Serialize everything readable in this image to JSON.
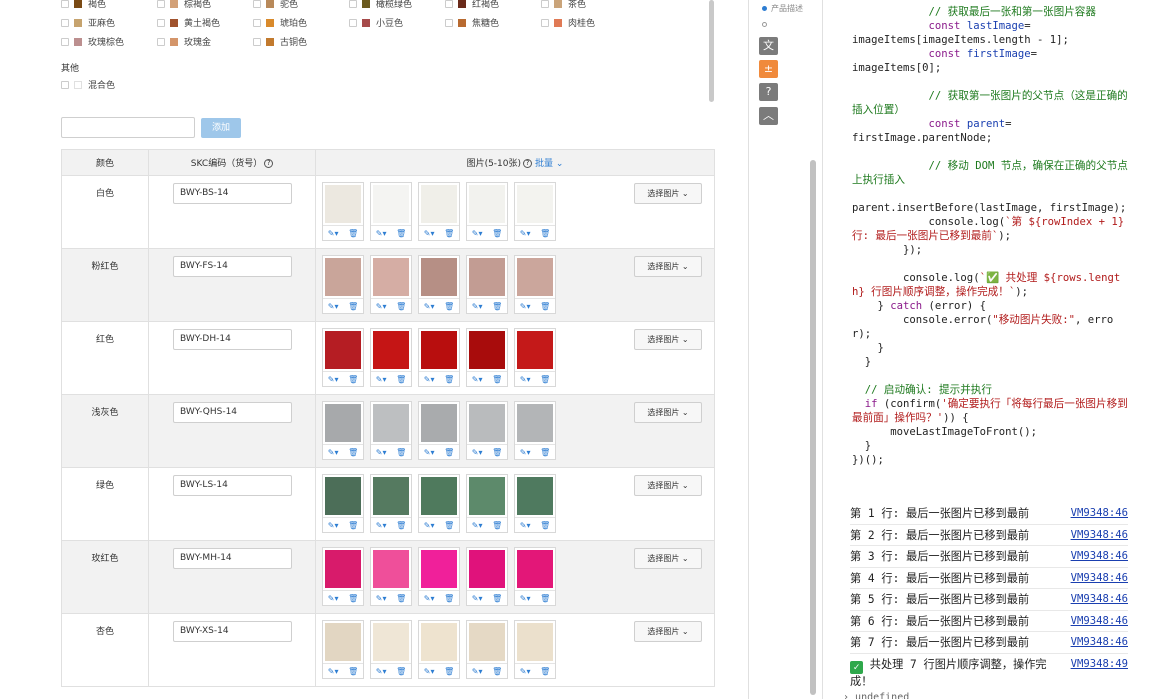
{
  "swatches": {
    "rows": [
      [
        {
          "label": "褐色",
          "color": "#7a4a14"
        },
        {
          "label": "棕褐色",
          "color": "#d2a077"
        },
        {
          "label": "驼色",
          "color": "#b8895a"
        },
        {
          "label": "橄榄绿色",
          "color": "#6b5a1e"
        },
        {
          "label": "红褐色",
          "color": "#6a2a1a"
        },
        {
          "label": "茶色",
          "color": "#caa47a"
        }
      ],
      [
        {
          "label": "亚麻色",
          "color": "#c6a36e"
        },
        {
          "label": "黄土褐色",
          "color": "#a0522d"
        },
        {
          "label": "琥珀色",
          "color": "#d98a2b"
        },
        {
          "label": "小豆色",
          "color": "#a64a4a"
        },
        {
          "label": "焦糖色",
          "color": "#b86a30"
        },
        {
          "label": "肉桂色",
          "color": "#e07a55"
        }
      ],
      [
        {
          "label": "玫瑰棕色",
          "color": "#bc8f8f"
        },
        {
          "label": "玫瑰金",
          "color": "#d4956a"
        },
        {
          "label": "古铜色",
          "color": "#c27a2e"
        }
      ]
    ],
    "other_title": "其他",
    "other_item": "混合色"
  },
  "add_form": {
    "input_value": "",
    "button": "添加"
  },
  "table": {
    "headers": {
      "color": "颜色",
      "skc": "SKC编码（货号）",
      "images": "图片(5-10张)",
      "batch": "批量"
    },
    "select_label": "选择图片",
    "rows": [
      {
        "color": "白色",
        "skc": "BWY-BS-14",
        "swatch": [
          "#ece8e0",
          "#f4f4f2",
          "#f0efe9",
          "#f2f2ee",
          "#f3f3ef"
        ]
      },
      {
        "color": "粉红色",
        "skc": "BWY-FS-14",
        "swatch": [
          "#c9a59a",
          "#d5ada4",
          "#b68f85",
          "#c29c93",
          "#cba69c"
        ]
      },
      {
        "color": "红色",
        "skc": "BWY-DH-14",
        "swatch": [
          "#b51d23",
          "#c51515",
          "#b80e0e",
          "#a80c0c",
          "#c41919"
        ]
      },
      {
        "color": "浅灰色",
        "skc": "BWY-QHS-14",
        "swatch": [
          "#a7a9ab",
          "#bdbfc1",
          "#a9abad",
          "#b9bbbd",
          "#b3b5b7"
        ]
      },
      {
        "color": "绿色",
        "skc": "BWY-LS-14",
        "swatch": [
          "#4c6e58",
          "#557a60",
          "#4f7a5d",
          "#5d8a6b",
          "#4f7a5f"
        ]
      },
      {
        "color": "玫红色",
        "skc": "BWY-MH-14",
        "swatch": [
          "#d81b6b",
          "#ef4f9a",
          "#f0209a",
          "#e0127b",
          "#e31778"
        ]
      },
      {
        "color": "杏色",
        "skc": "BWY-XS-14",
        "swatch": [
          "#e2d6c2",
          "#efe6d6",
          "#eee3cf",
          "#e5d9c5",
          "#ebe0cc"
        ]
      }
    ]
  },
  "side_strip": {
    "label": "产品描述"
  },
  "console": {
    "code_lines": [
      {
        "t": "cm",
        "s": "            // 获取最后一张和第一张图片容器"
      },
      {
        "t": "mix",
        "parts": [
          [
            "kw",
            "            const "
          ],
          [
            "vr",
            "lastImage"
          ],
          [
            "",
            "="
          ]
        ]
      },
      {
        "t": "",
        "s": "imageItems[imageItems.length - 1];"
      },
      {
        "t": "mix",
        "parts": [
          [
            "kw",
            "            const "
          ],
          [
            "vr",
            "firstImage"
          ],
          [
            "",
            "="
          ]
        ]
      },
      {
        "t": "",
        "s": "imageItems[0];"
      },
      {
        "t": "",
        "s": " "
      },
      {
        "t": "cm",
        "s": "            // 获取第一张图片的父节点（这是正确的插入位置）"
      },
      {
        "t": "mix",
        "parts": [
          [
            "kw",
            "            const "
          ],
          [
            "vr",
            "parent"
          ],
          [
            "",
            "="
          ]
        ]
      },
      {
        "t": "",
        "s": "firstImage.parentNode;"
      },
      {
        "t": "",
        "s": " "
      },
      {
        "t": "cm",
        "s": "            // 移动 DOM 节点，确保在正确的父节点上执行插入"
      },
      {
        "t": "",
        "s": " "
      },
      {
        "t": "",
        "s": "parent.insertBefore(lastImage, firstImage);"
      },
      {
        "t": "mix",
        "parts": [
          [
            "",
            "            console.log("
          ],
          [
            "st",
            "`第 ${rowIndex + 1} 行: 最后一张图片已移到最前`"
          ],
          [
            "",
            ");"
          ]
        ]
      },
      {
        "t": "",
        "s": "        });"
      },
      {
        "t": "",
        "s": " "
      },
      {
        "t": "mix",
        "parts": [
          [
            "",
            "        console.log("
          ],
          [
            "st",
            "`✅ 共处理 ${rows.length} 行图片顺序调整，操作完成！`"
          ],
          [
            "",
            ");"
          ]
        ]
      },
      {
        "t": "mix",
        "parts": [
          [
            "",
            "    } "
          ],
          [
            "kw",
            "catch"
          ],
          [
            "",
            " (error) {"
          ]
        ]
      },
      {
        "t": "mix",
        "parts": [
          [
            "",
            "        console.error("
          ],
          [
            "st",
            "\"移动图片失败:\""
          ],
          [
            "",
            ", error);"
          ]
        ]
      },
      {
        "t": "",
        "s": "    }"
      },
      {
        "t": "",
        "s": "  }"
      },
      {
        "t": "",
        "s": " "
      },
      {
        "t": "cm",
        "s": "  // 启动确认: 提示并执行"
      },
      {
        "t": "mix",
        "parts": [
          [
            "kw",
            "  if"
          ],
          [
            "",
            " (confirm("
          ],
          [
            "st",
            "'确定要执行「将每行最后一张图片移到最前面」操作吗？'"
          ],
          [
            "",
            ")) {"
          ]
        ]
      },
      {
        "t": "",
        "s": "      moveLastImageToFront();"
      },
      {
        "t": "",
        "s": "  }"
      },
      {
        "t": "",
        "s": "})();"
      }
    ],
    "logs": [
      {
        "text": "第 1 行: 最后一张图片已移到最前",
        "src": "VM9348:46"
      },
      {
        "text": "第 2 行: 最后一张图片已移到最前",
        "src": "VM9348:46"
      },
      {
        "text": "第 3 行: 最后一张图片已移到最前",
        "src": "VM9348:46"
      },
      {
        "text": "第 4 行: 最后一张图片已移到最前",
        "src": "VM9348:46"
      },
      {
        "text": "第 5 行: 最后一张图片已移到最前",
        "src": "VM9348:46"
      },
      {
        "text": "第 6 行: 最后一张图片已移到最前",
        "src": "VM9348:46"
      },
      {
        "text": "第 7 行: 最后一张图片已移到最前",
        "src": "VM9348:46"
      }
    ],
    "final_log": {
      "text": "共处理 7 行图片顺序调整，操作完成！",
      "src": "VM9348:49"
    },
    "undefined": "undefined"
  }
}
